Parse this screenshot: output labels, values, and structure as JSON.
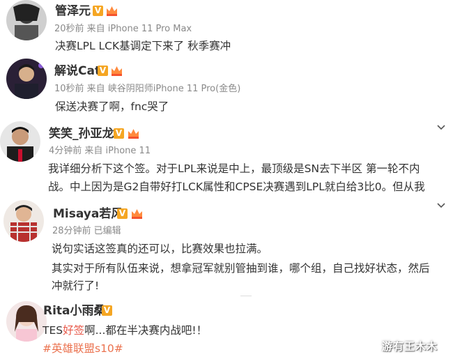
{
  "comments": [
    {
      "username": "管泽元",
      "meta": "20秒前 来自 iPhone 11 Pro Max",
      "lines": [
        "决赛LPL LCK基调定下来了 秋季赛冲"
      ]
    },
    {
      "username": "解说Cat",
      "meta": "10秒前 来自 峡谷阴阳师iPhone 11 Pro(金色)",
      "lines": [
        "保送决赛了啊，fnc哭了"
      ]
    },
    {
      "username": "笑笑_孙亚龙",
      "meta": "4分钟前 来自 iPhone 11",
      "lines": [
        "我详细分析下这个签。对于LPL来说是中上，最顶级是SN去下半区 第一轮不内",
        "战。中上因为是G2自带好打LCK属性和CPSE决赛遇到LPL就白给3比0。但从我"
      ]
    },
    {
      "username": "Misaya若风",
      "meta": "28分钟前  已编辑",
      "lines": [
        "说句实话这签真的还可以，比赛效果也拉满。",
        "其实对于所有队伍来说，想拿冠军就别管抽到谁，哪个组，自己找好状态，然后",
        "冲就行了!"
      ]
    },
    {
      "username": "Rita小雨桑",
      "text_prefix": "TES",
      "text_highlight": "好签",
      "text_suffix": "啊...都在半决赛内战吧!！",
      "hashtag": "#英雄联盟s10#"
    }
  ],
  "badge_letter": "V",
  "watermark": "游有王木木",
  "colors": {
    "vip_badge": "#f5a623",
    "highlight": "#e8594a",
    "hashtag": "#eb7350",
    "meta": "#8a8a8a"
  }
}
